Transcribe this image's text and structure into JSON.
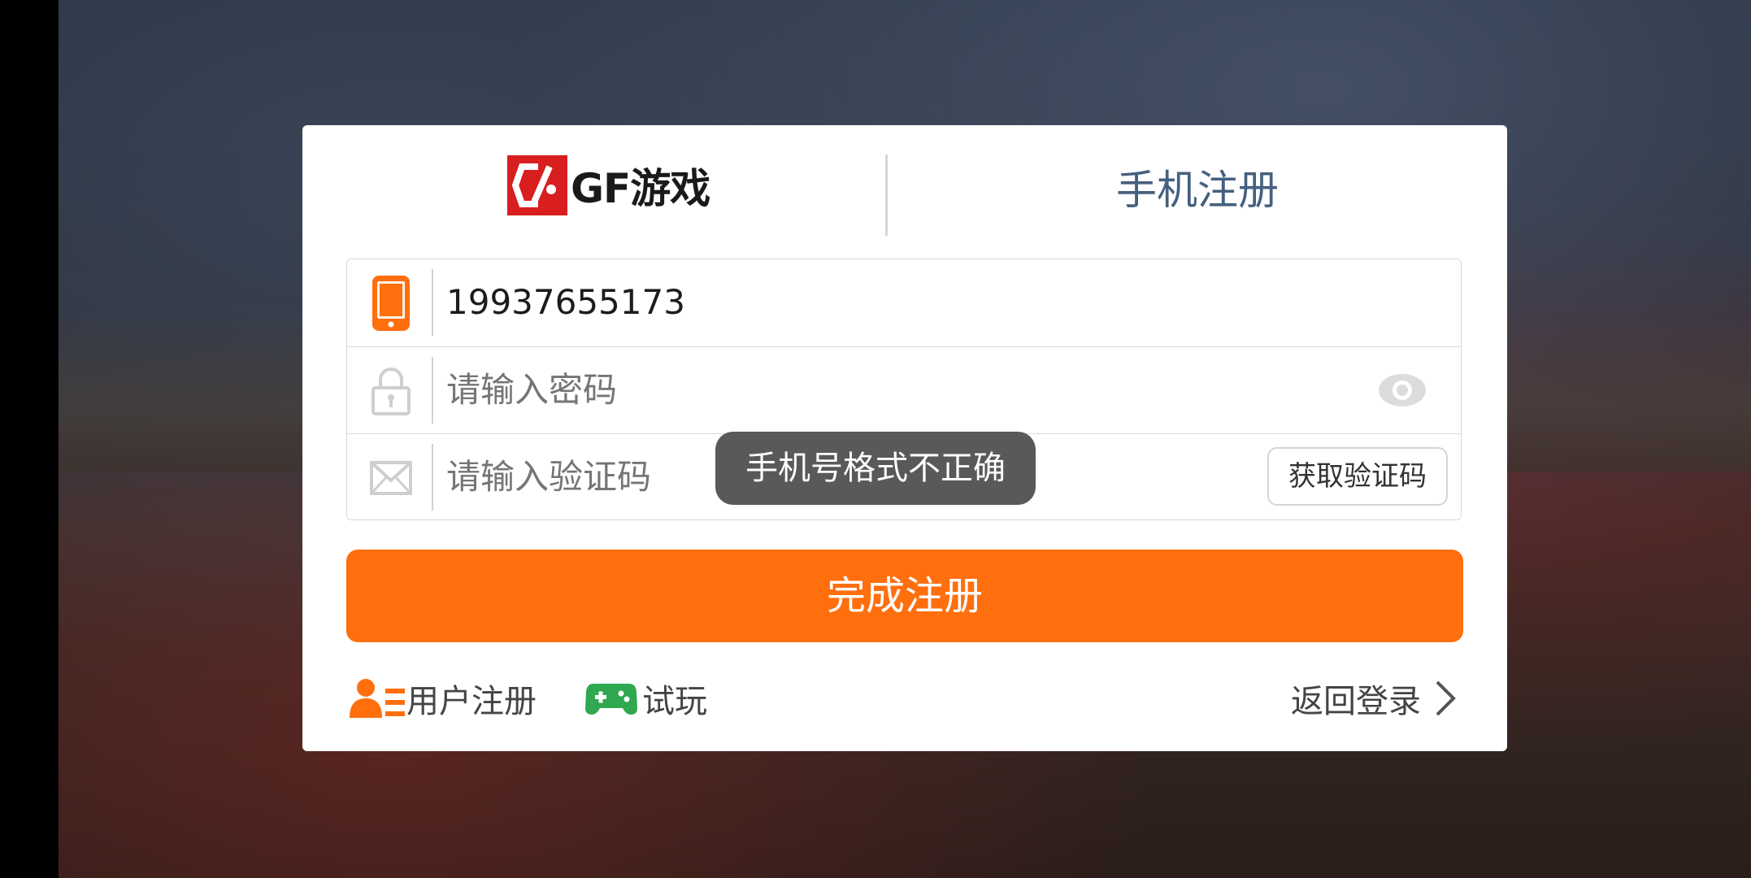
{
  "header": {
    "brand": "GF游戏",
    "title": "手机注册"
  },
  "form": {
    "phone_value": "19937655173",
    "password_placeholder": "请输入密码",
    "code_placeholder": "请输入验证码",
    "get_code_label": "获取验证码"
  },
  "toast": "手机号格式不正确",
  "submit_label": "完成注册",
  "links": {
    "user_register": "用户注册",
    "trial": "试玩",
    "back_login": "返回登录"
  },
  "colors": {
    "accent": "#ff6f0e",
    "title": "#45607f",
    "logo_red": "#d81e1e",
    "trial_green": "#2fa84f"
  },
  "icons": {
    "phone": "phone-icon",
    "lock": "lock-icon",
    "mail": "mail-icon",
    "eye": "eye-icon",
    "user": "user-icon",
    "gamepad": "gamepad-icon",
    "chevron": "chevron-right-icon"
  }
}
